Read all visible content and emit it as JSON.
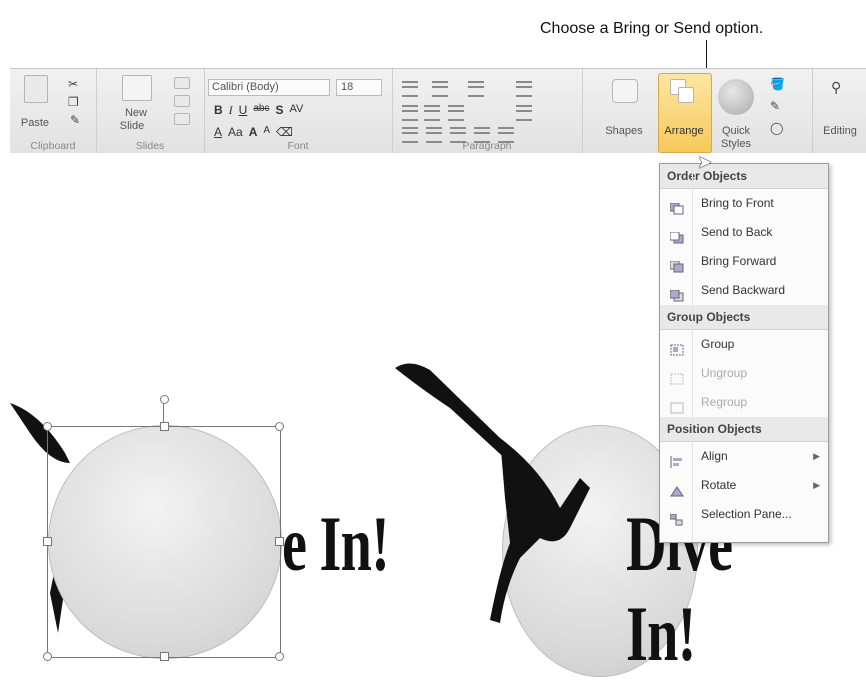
{
  "callout": "Choose a Bring or Send option.",
  "ribbon": {
    "clipboard": {
      "paste": "Paste",
      "group": "Clipboard"
    },
    "slides": {
      "new_slide_1": "New",
      "new_slide_2": "Slide",
      "group": "Slides"
    },
    "font": {
      "name": "Calibri (Body)",
      "size": "18",
      "bold": "B",
      "italic": "I",
      "underline": "U",
      "strike": "abc",
      "shadow": "S",
      "spacing": "AV",
      "color": "A",
      "case": "Aa",
      "grow": "A",
      "shrink": "A",
      "group": "Font"
    },
    "paragraph": {
      "group": "Paragraph"
    },
    "drawing": {
      "shapes": "Shapes",
      "arrange": "Arrange",
      "quick_styles_1": "Quick",
      "quick_styles_2": "Styles"
    },
    "editing": {
      "label": "Editing"
    }
  },
  "slide": {
    "left_text": "e In!",
    "right_text": "Dive In!"
  },
  "menu": {
    "sections": [
      {
        "title": "Order Objects",
        "items": [
          {
            "label": "Bring to Front",
            "icon": "bring-to-front-icon",
            "enabled": true
          },
          {
            "label": "Send to Back",
            "icon": "send-to-back-icon",
            "enabled": true
          },
          {
            "label": "Bring Forward",
            "icon": "bring-forward-icon",
            "enabled": true
          },
          {
            "label": "Send Backward",
            "icon": "send-backward-icon",
            "enabled": true
          }
        ]
      },
      {
        "title": "Group Objects",
        "items": [
          {
            "label": "Group",
            "icon": "group-icon",
            "enabled": true
          },
          {
            "label": "Ungroup",
            "icon": "ungroup-icon",
            "enabled": false
          },
          {
            "label": "Regroup",
            "icon": "regroup-icon",
            "enabled": false
          }
        ]
      },
      {
        "title": "Position Objects",
        "items": [
          {
            "label": "Align",
            "icon": "align-icon",
            "enabled": true,
            "submenu": true
          },
          {
            "label": "Rotate",
            "icon": "rotate-icon",
            "enabled": true,
            "submenu": true
          },
          {
            "label": "Selection Pane...",
            "icon": "selection-pane-icon",
            "enabled": true
          }
        ]
      }
    ]
  }
}
